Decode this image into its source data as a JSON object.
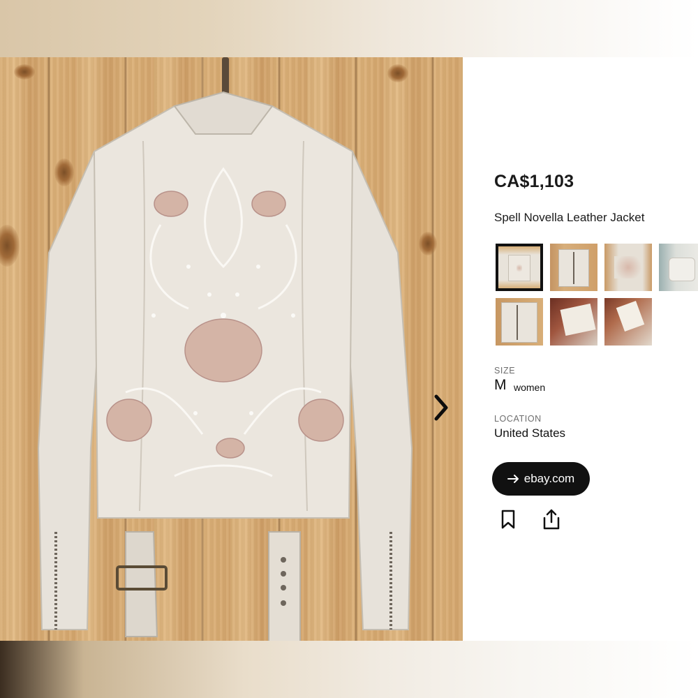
{
  "listing": {
    "price": "CA$1,103",
    "title": "Spell Novella Leather Jacket",
    "size_label": "SIZE",
    "size_value": "M",
    "size_note": "women",
    "location_label": "LOCATION",
    "location_value": "United States",
    "source_button": "ebay.com"
  },
  "icons": {
    "next": "chevron-right-icon",
    "source_arrow": "arrow-right-icon",
    "save": "bookmark-icon",
    "share": "share-icon"
  },
  "thumbnails": [
    {
      "selected": true,
      "depicts": "jacket-back"
    },
    {
      "selected": false,
      "depicts": "jacket-front"
    },
    {
      "selected": false,
      "depicts": "jacket-back-detail"
    },
    {
      "selected": false,
      "depicts": "jacket-partial"
    },
    {
      "selected": false,
      "depicts": "jacket-front-collar"
    },
    {
      "selected": false,
      "depicts": "care-label"
    },
    {
      "selected": false,
      "depicts": "size-tag"
    }
  ],
  "colors": {
    "jacket": "#e9e4dc",
    "embroidery": "#c9a79a",
    "wood": "#d8ad75",
    "button_bg": "#111111",
    "selected_border": "#111111"
  }
}
